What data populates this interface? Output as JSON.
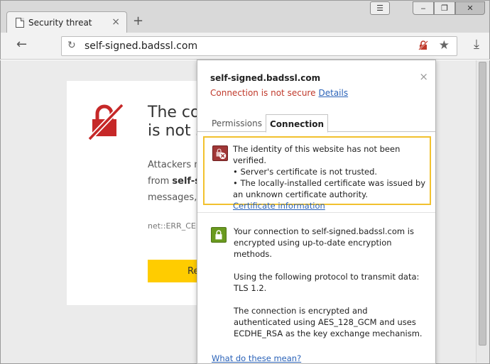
{
  "tab": {
    "title": "Security threat",
    "close": "×",
    "new_tab": "+"
  },
  "window": {
    "menu": "☰",
    "min": "‒",
    "max": "❐",
    "close": "✕"
  },
  "toolbar": {
    "back": "←",
    "reload": "↻",
    "url": "self-signed.badssl.com",
    "star": "★",
    "download": "⤓"
  },
  "interstitial": {
    "heading_line1": "The co",
    "heading_line2": "is not s",
    "para_line1": "Attackers m",
    "para_line2_bold": "self-si",
    "para_line2_prefix": "from ",
    "para_line3": "messages, c",
    "error_code": "net::ERR_CERT",
    "button_label": "Re"
  },
  "popup": {
    "site": "self-signed.badssl.com",
    "close": "×",
    "status": "Connection is not secure",
    "details_link": "Details",
    "tabs": [
      "Permissions",
      "Connection"
    ],
    "warning": {
      "line1": "The identity of this website has not been verified.",
      "line2": "• Server's certificate is not trusted.",
      "line3": "• The locally-installed certificate was issued by an unknown certificate authority.",
      "link": "Certificate information"
    },
    "connection": {
      "p1": "Your connection to self-signed.badssl.com is encrypted using up-to-date encryption methods.",
      "p2": "Using the following protocol to transmit data: TLS 1.2.",
      "p3": "The connection is encrypted and authenticated using AES_128_GCM and uses ECDHE_RSA as the key exchange mechanism."
    },
    "help_link": "What do these mean?"
  },
  "colors": {
    "danger": "#c0392b",
    "link": "#2a62b8",
    "warning_border": "#f2c12e",
    "ok": "#6a9a1f",
    "button": "#ffcc00"
  }
}
